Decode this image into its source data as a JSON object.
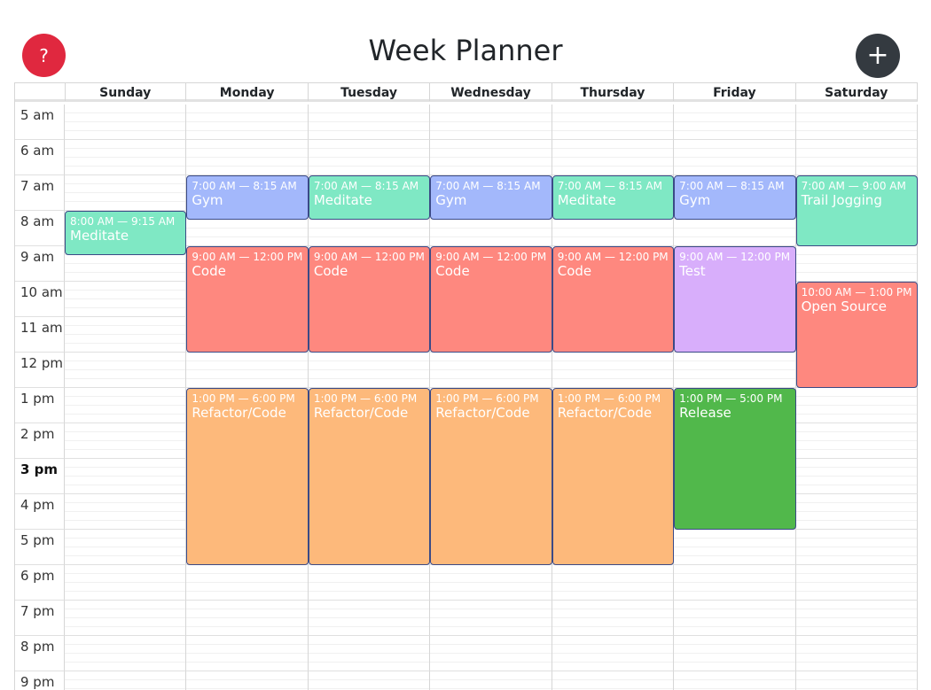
{
  "header": {
    "title": "Week Planner",
    "help_label": "?",
    "add_label": "+"
  },
  "colors": {
    "help": "#e0283f",
    "add": "#343a40",
    "blue": "#a3b8fb",
    "green": "#7fe8c4",
    "red": "#fe887f",
    "orange": "#fdb97b",
    "purple": "#d8aefb",
    "dark_green": "#51b84b"
  },
  "days": [
    "Sunday",
    "Monday",
    "Tuesday",
    "Wednesday",
    "Thursday",
    "Friday",
    "Saturday"
  ],
  "hours": [
    {
      "label": "5 am",
      "bold": false
    },
    {
      "label": "6 am",
      "bold": false
    },
    {
      "label": "7 am",
      "bold": false
    },
    {
      "label": "8 am",
      "bold": false
    },
    {
      "label": "9 am",
      "bold": false
    },
    {
      "label": "10 am",
      "bold": false
    },
    {
      "label": "11 am",
      "bold": false
    },
    {
      "label": "12 pm",
      "bold": false
    },
    {
      "label": "1 pm",
      "bold": false
    },
    {
      "label": "2 pm",
      "bold": false
    },
    {
      "label": "3 pm",
      "bold": true
    },
    {
      "label": "4 pm",
      "bold": false
    },
    {
      "label": "5 pm",
      "bold": false
    },
    {
      "label": "6 pm",
      "bold": false
    },
    {
      "label": "7 pm",
      "bold": false
    },
    {
      "label": "8 pm",
      "bold": false
    },
    {
      "label": "9 pm",
      "bold": false
    }
  ],
  "events": [
    {
      "day": 0,
      "start": 8,
      "end": 9.25,
      "time": "8:00 AM — 9:15 AM",
      "title": "Meditate",
      "color": "#7fe8c4"
    },
    {
      "day": 1,
      "start": 7,
      "end": 8.25,
      "time": "7:00 AM — 8:15 AM",
      "title": "Gym",
      "color": "#a3b8fb"
    },
    {
      "day": 2,
      "start": 7,
      "end": 8.25,
      "time": "7:00 AM — 8:15 AM",
      "title": "Meditate",
      "color": "#7fe8c4"
    },
    {
      "day": 3,
      "start": 7,
      "end": 8.25,
      "time": "7:00 AM — 8:15 AM",
      "title": "Gym",
      "color": "#a3b8fb"
    },
    {
      "day": 4,
      "start": 7,
      "end": 8.25,
      "time": "7:00 AM — 8:15 AM",
      "title": "Meditate",
      "color": "#7fe8c4"
    },
    {
      "day": 5,
      "start": 7,
      "end": 8.25,
      "time": "7:00 AM — 8:15 AM",
      "title": "Gym",
      "color": "#a3b8fb"
    },
    {
      "day": 6,
      "start": 7,
      "end": 9,
      "time": "7:00 AM — 9:00 AM",
      "title": "Trail Jogging",
      "color": "#7fe8c4"
    },
    {
      "day": 1,
      "start": 9,
      "end": 12,
      "time": "9:00 AM — 12:00 PM",
      "title": "Code",
      "color": "#fe887f"
    },
    {
      "day": 2,
      "start": 9,
      "end": 12,
      "time": "9:00 AM — 12:00 PM",
      "title": "Code",
      "color": "#fe887f"
    },
    {
      "day": 3,
      "start": 9,
      "end": 12,
      "time": "9:00 AM — 12:00 PM",
      "title": "Code",
      "color": "#fe887f"
    },
    {
      "day": 4,
      "start": 9,
      "end": 12,
      "time": "9:00 AM — 12:00 PM",
      "title": "Code",
      "color": "#fe887f"
    },
    {
      "day": 5,
      "start": 9,
      "end": 12,
      "time": "9:00 AM — 12:00 PM",
      "title": "Test",
      "color": "#d8aefb"
    },
    {
      "day": 6,
      "start": 10,
      "end": 13,
      "time": "10:00 AM — 1:00 PM",
      "title": "Open Source",
      "color": "#fe887f"
    },
    {
      "day": 1,
      "start": 13,
      "end": 18,
      "time": "1:00 PM — 6:00 PM",
      "title": "Refactor/Code",
      "color": "#fdb97b"
    },
    {
      "day": 2,
      "start": 13,
      "end": 18,
      "time": "1:00 PM — 6:00 PM",
      "title": "Refactor/Code",
      "color": "#fdb97b"
    },
    {
      "day": 3,
      "start": 13,
      "end": 18,
      "time": "1:00 PM — 6:00 PM",
      "title": "Refactor/Code",
      "color": "#fdb97b"
    },
    {
      "day": 4,
      "start": 13,
      "end": 18,
      "time": "1:00 PM — 6:00 PM",
      "title": "Refactor/Code",
      "color": "#fdb97b"
    },
    {
      "day": 5,
      "start": 13,
      "end": 17,
      "time": "1:00 PM — 5:00 PM",
      "title": "Release",
      "color": "#51b84b"
    }
  ]
}
